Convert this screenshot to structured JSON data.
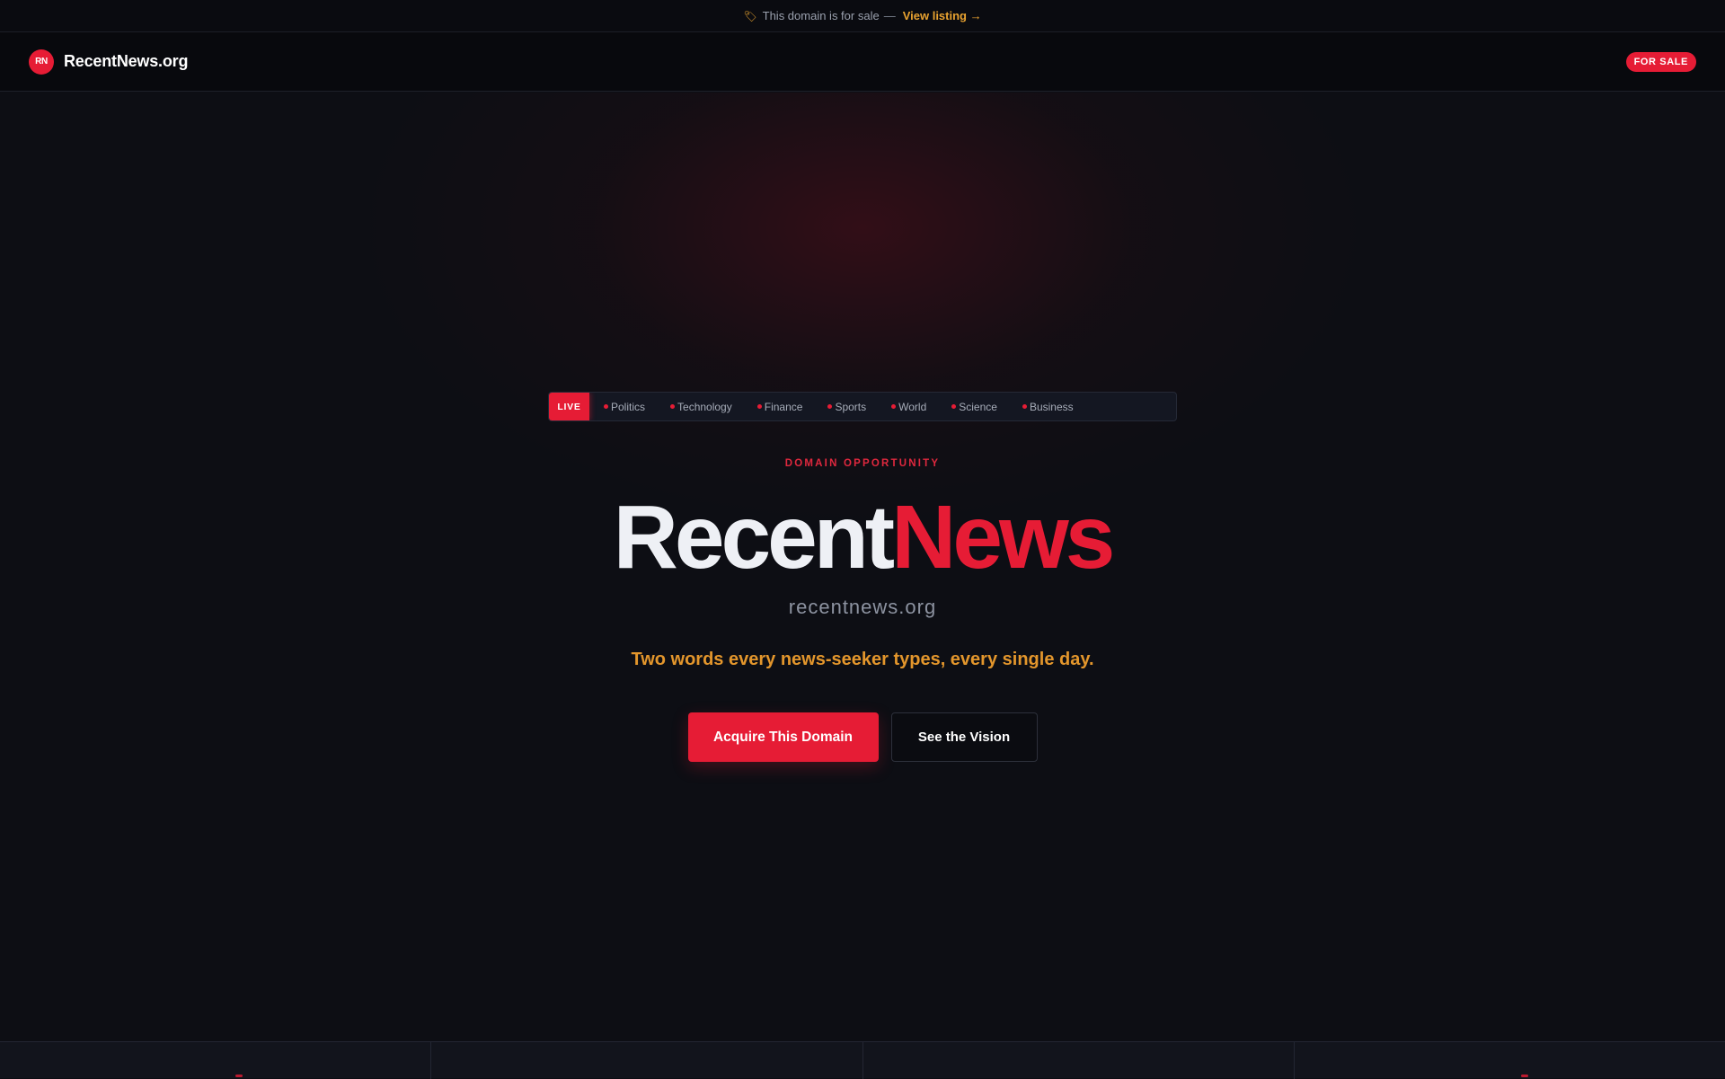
{
  "announcement": {
    "icon": "price-tag-icon",
    "text": "This domain is for sale",
    "separator": "—",
    "link_label": "View listing →"
  },
  "header": {
    "logo_initials": "RN",
    "brand_name": "RecentNews.org",
    "badge": "FOR SALE"
  },
  "ticker": {
    "live_label": "LIVE",
    "items": [
      "Politics",
      "Technology",
      "Finance",
      "Sports",
      "World",
      "Science",
      "Business"
    ]
  },
  "hero": {
    "eyebrow": "DOMAIN OPPORTUNITY",
    "headline_part1": "Recent",
    "headline_part2": "News",
    "domain": "recentnews.org",
    "tagline": "Two words every news-seeker types, every single day.",
    "cta_primary": "Acquire This Domain",
    "cta_secondary": "See the Vision"
  },
  "colors": {
    "accent_red": "#e61c35",
    "accent_orange": "#e3962c",
    "background": "#0d0e14"
  }
}
